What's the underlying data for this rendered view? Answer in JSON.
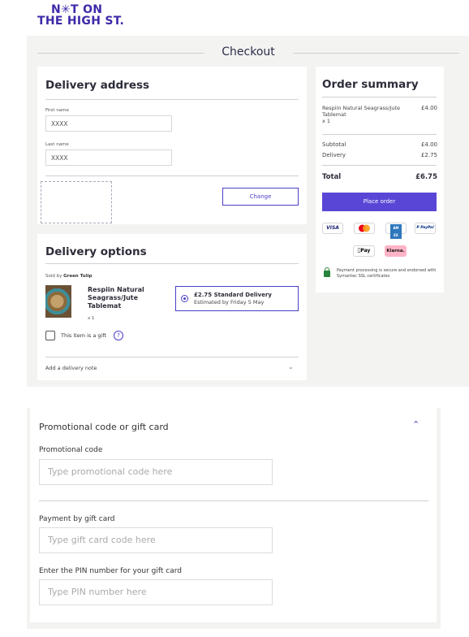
{
  "brand": {
    "logo_line1": "N✳T ON",
    "logo_line2": "THE HIGH ST."
  },
  "page_title": "Checkout",
  "delivery_address": {
    "heading": "Delivery address",
    "first_name_label": "First name",
    "first_name_value": "XXXX",
    "last_name_label": "Last name",
    "last_name_value": "XXXX",
    "change_label": "Change"
  },
  "delivery_options": {
    "heading": "Delivery options",
    "sold_by_prefix": "Sold by",
    "seller": "Green Tulip",
    "product_name": "Respiin Natural Seagrass/Jute Tablemat",
    "product_qty": "x 1",
    "option_title": "£2.75 Standard Delivery",
    "option_sub": "Estimated by Friday 5 May",
    "gift_label": "This item is a gift",
    "help_glyph": "?",
    "note_label": "Add a delivery note"
  },
  "order_summary": {
    "heading": "Order summary",
    "item_name": "Respiin Natural Seagrass/Jute Tablemat",
    "item_qty": "x 1",
    "item_price": "£4.00",
    "subtotal_label": "Subtotal",
    "subtotal_value": "£4.00",
    "delivery_label": "Delivery",
    "delivery_value": "£2.75",
    "total_label": "Total",
    "total_value": "£6.75",
    "place_order_label": "Place order",
    "payment_logos": [
      "VISA",
      "Mastercard",
      "AMEX",
      "PayPal",
      "Apple Pay",
      "Klarna."
    ],
    "paypal_text": "P PayPal",
    "applepay_text": "Pay",
    "klarna_text": "Klarna.",
    "amex_text": "AM EX",
    "visa_text": "VISA",
    "secure_text": "Payment processing is secure and endorsed with Symantec SSL certificates"
  },
  "promo": {
    "title": "Promotional code or gift card",
    "promo_label": "Promotional code",
    "promo_placeholder": "Type promotional code here",
    "gift_card_label": "Payment by gift card",
    "gift_card_placeholder": "Type gift card code here",
    "pin_label": "Enter the PIN number for your gift card",
    "pin_placeholder": "Type PIN number here"
  },
  "colors": {
    "brand": "#3d2aa8",
    "accent": "#5a46d6",
    "background_gray": "#f3f3f2",
    "secure_green": "#27843a"
  }
}
